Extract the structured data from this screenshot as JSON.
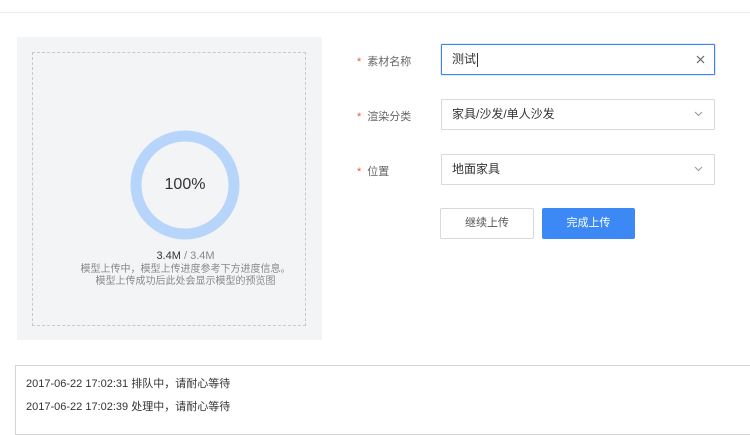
{
  "upload": {
    "progress_label": "100%",
    "progress_fraction": 1.0,
    "uploaded": "3.4M",
    "separator": "/",
    "total": "3.4M",
    "hint_line1": "模型上传中，模型上传进度参考下方进度信息。",
    "hint_line2": "模型上传成功后此处会显示模型的预览图"
  },
  "form": {
    "required_mark": "*",
    "name": {
      "label": "素材名称",
      "value": "测试"
    },
    "category": {
      "label": "渲染分类",
      "value": "家具/沙发/单人沙发"
    },
    "position": {
      "label": "位置",
      "value": "地面家具"
    }
  },
  "buttons": {
    "continue_label": "继续上传",
    "finish_label": "完成上传"
  },
  "log": {
    "lines": [
      "2017-06-22 17:02:31 排队中，请耐心等待",
      "2017-06-22 17:02:39 处理中，请耐心等待"
    ]
  },
  "colors": {
    "accent": "#3c89f5",
    "ring": "#b7d5fb",
    "required": "#f25a2a"
  },
  "icons": {
    "clear": "close-icon",
    "dropdown": "chevron-down-icon"
  }
}
